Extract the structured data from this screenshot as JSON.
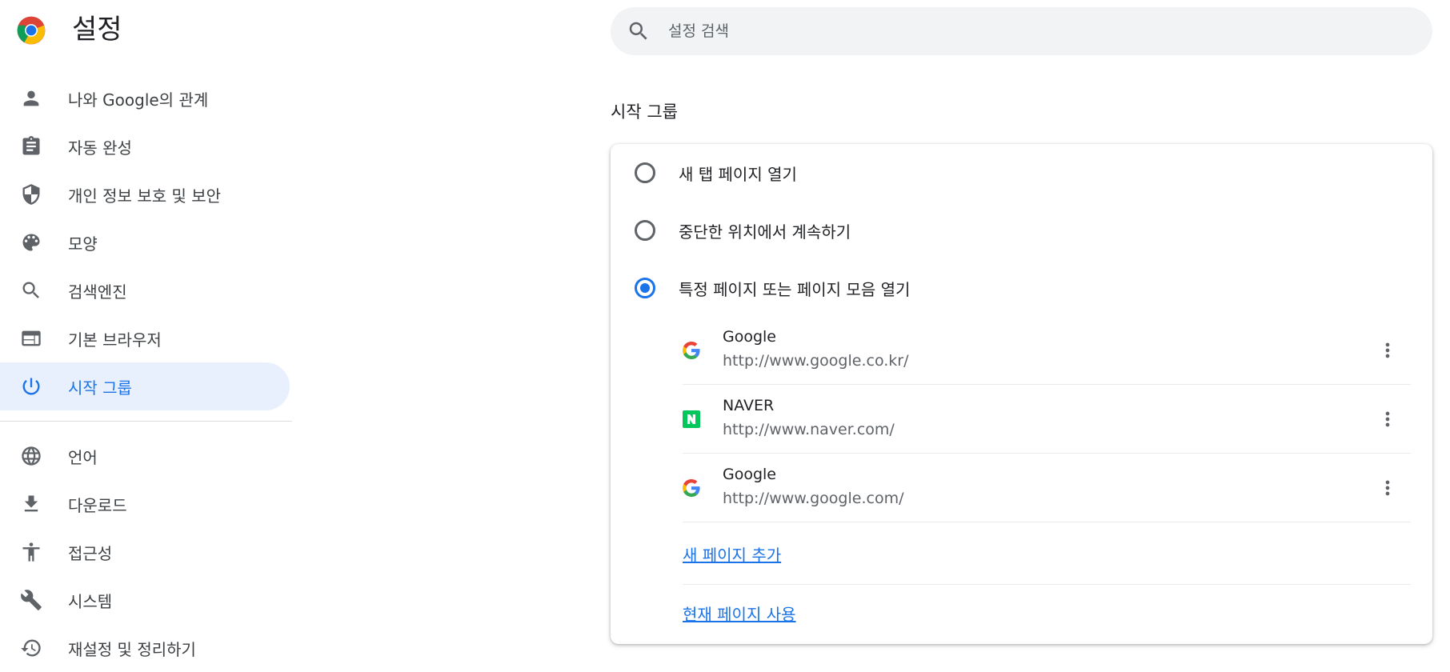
{
  "app": {
    "title": "설정"
  },
  "search": {
    "placeholder": "설정 검색",
    "value": ""
  },
  "sidebar": {
    "items": [
      {
        "label": "나와 Google의 관계",
        "icon": "person-icon",
        "active": false
      },
      {
        "label": "자동 완성",
        "icon": "clipboard-icon",
        "active": false
      },
      {
        "label": "개인 정보 보호 및 보안",
        "icon": "shield-icon",
        "active": false
      },
      {
        "label": "모양",
        "icon": "palette-icon",
        "active": false
      },
      {
        "label": "검색엔진",
        "icon": "search-icon",
        "active": false
      },
      {
        "label": "기본 브라우저",
        "icon": "browser-icon",
        "active": false
      },
      {
        "label": "시작 그룹",
        "icon": "power-icon",
        "active": true
      },
      {
        "label": "언어",
        "icon": "globe-icon",
        "active": false
      },
      {
        "label": "다운로드",
        "icon": "download-icon",
        "active": false
      },
      {
        "label": "접근성",
        "icon": "accessibility-icon",
        "active": false
      },
      {
        "label": "시스템",
        "icon": "wrench-icon",
        "active": false
      },
      {
        "label": "재설정 및 정리하기",
        "icon": "history-icon",
        "active": false
      }
    ]
  },
  "main": {
    "section_title": "시작 그룹",
    "options": [
      {
        "label": "새 탭 페이지 열기",
        "checked": false
      },
      {
        "label": "중단한 위치에서 계속하기",
        "checked": false
      },
      {
        "label": "특정 페이지 또는 페이지 모음 열기",
        "checked": true
      }
    ],
    "pages": [
      {
        "name": "Google",
        "url": "http://www.google.co.kr/",
        "favicon": "google-favicon-icon"
      },
      {
        "name": "NAVER",
        "url": "http://www.naver.com/",
        "favicon": "naver-favicon-icon"
      },
      {
        "name": "Google",
        "url": "http://www.google.com/",
        "favicon": "google-favicon-icon"
      }
    ],
    "add_page_link": "새 페이지 추가",
    "use_current_link": "현재 페이지 사용"
  },
  "colors": {
    "accent": "#1a73e8",
    "active_bg": "#e8f0fe",
    "naver_green": "#03c75a"
  }
}
